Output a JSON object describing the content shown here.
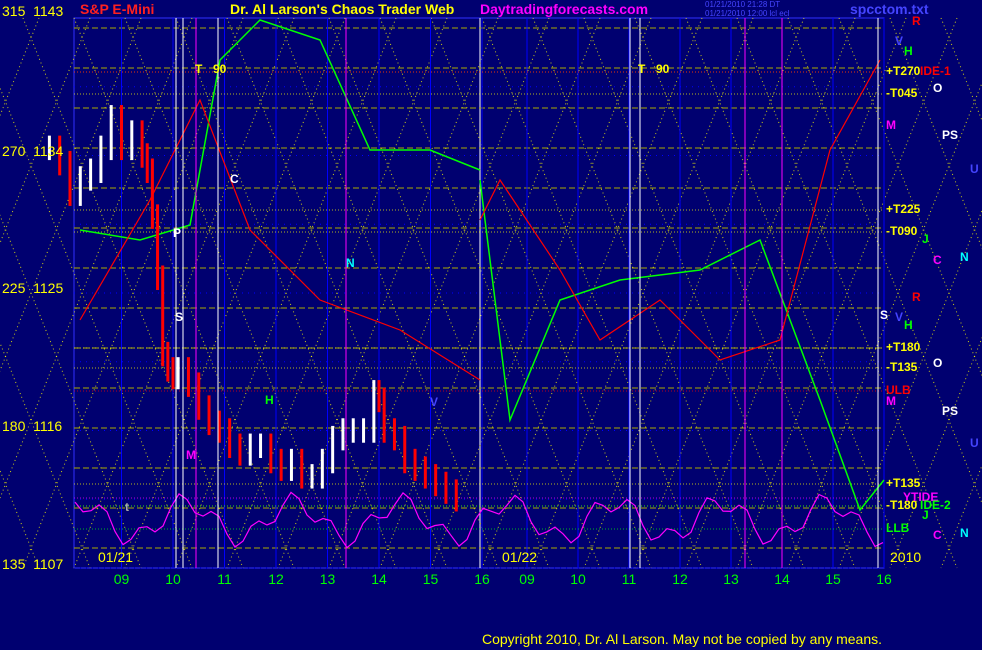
{
  "header": {
    "symbol": "S&P E-Mini",
    "title": "Dr. Al Larson's Chaos Trader Web",
    "website": "Daytradingforecasts.com",
    "timestamp1": "01/21/2010 21:28 DT",
    "timestamp2": "01/21/2010 12:00 lcl ecl",
    "filename": "spcctom.txt"
  },
  "colors": {
    "background": "#000070",
    "price_bar": "#ff0000",
    "price_bar_up": "#ffffff",
    "green_line": "#00ff00",
    "red_line": "#ff0000",
    "magenta_line": "#ff00ff",
    "grid_blue": "#0000ff",
    "dotted_yellow": "#ffff00"
  },
  "chart_data": {
    "type": "line",
    "title": "S&P E-Mini",
    "y_price_ticks": [
      "1143",
      "1134",
      "1125",
      "1116",
      "1107"
    ],
    "y_degree_ticks": [
      "315",
      "270",
      "225",
      "180",
      "135"
    ],
    "ylim": [
      1107,
      1143
    ],
    "x_ticks_day1": [
      "09",
      "10",
      "11",
      "12",
      "13",
      "14",
      "15",
      "16"
    ],
    "x_ticks_day2": [
      "09",
      "10",
      "11",
      "12",
      "13",
      "14",
      "15",
      "16"
    ],
    "dates": [
      "01/21",
      "01/22"
    ],
    "year": "2010",
    "price_series": {
      "name": "S&P E-Mini",
      "x_hours": [
        8.1,
        8.3,
        8.5,
        8.7,
        8.9,
        9.1,
        9.3,
        9.5,
        9.7,
        9.9,
        10.0,
        10.1,
        10.2,
        10.3,
        10.4,
        10.5,
        10.6,
        10.8,
        11.0,
        11.2,
        11.4,
        11.6,
        11.8,
        12.0,
        12.2,
        12.4,
        12.6,
        12.8,
        13.0,
        13.2,
        13.4,
        13.6,
        13.8,
        14.0,
        14.2,
        14.4,
        14.5,
        14.6,
        14.8,
        15.0,
        15.2,
        15.4,
        15.6,
        15.8,
        16.0
      ],
      "close": [
        1134.5,
        1133.5,
        1131.5,
        1132.5,
        1133,
        1134.5,
        1136.5,
        1134.5,
        1135.5,
        1134,
        1133,
        1130,
        1126,
        1121,
        1120,
        1119.5,
        1120,
        1119,
        1117.5,
        1116.5,
        1116,
        1115,
        1114.5,
        1115,
        1115,
        1114,
        1113.5,
        1114,
        1113,
        1113,
        1114,
        1115.5,
        1116,
        1116,
        1116,
        1118.5,
        1118,
        1116,
        1115.5,
        1114,
        1113.5,
        1113,
        1112.5,
        1112,
        1111.5
      ]
    },
    "timeline_labels": [
      {
        "text": "T",
        "extra": "90"
      },
      {
        "text": "C"
      },
      {
        "text": "P"
      },
      {
        "text": "S"
      },
      {
        "text": "N"
      },
      {
        "text": "H"
      },
      {
        "text": "M"
      },
      {
        "text": "V"
      },
      {
        "text": "t"
      }
    ],
    "right_levels": [
      {
        "text": "+T270",
        "color": "#ffff00"
      },
      {
        "text": "-T045",
        "color": "#ffff00"
      },
      {
        "text": "+T225",
        "color": "#ffff00"
      },
      {
        "text": "-T090",
        "color": "#ffff00"
      },
      {
        "text": "+T180",
        "color": "#ffff00"
      },
      {
        "text": "-T135",
        "color": "#ffff00"
      },
      {
        "text": "ULB",
        "color": "#ff0000"
      },
      {
        "text": "+T135",
        "color": "#ffff00"
      },
      {
        "text": "-T180",
        "color": "#ffff00"
      },
      {
        "text": "LLB",
        "color": "#00ff00"
      },
      {
        "text": "YTIDE",
        "color": "#ff00ff"
      },
      {
        "text": "IDE-1",
        "color": "#ff0000"
      },
      {
        "text": "IDE-2",
        "color": "#00ff00"
      }
    ],
    "planet_labels_1": [
      "R",
      "V",
      "H",
      "O",
      "M",
      "PS",
      "U",
      "J",
      "C",
      "N",
      "R",
      "S",
      "V",
      "H",
      "O",
      "M",
      "PS",
      "U",
      "J",
      "C",
      "N"
    ]
  },
  "footer": {
    "copyright": "Copyright 2010, Dr. Al Larson. May not be copied by any means."
  }
}
